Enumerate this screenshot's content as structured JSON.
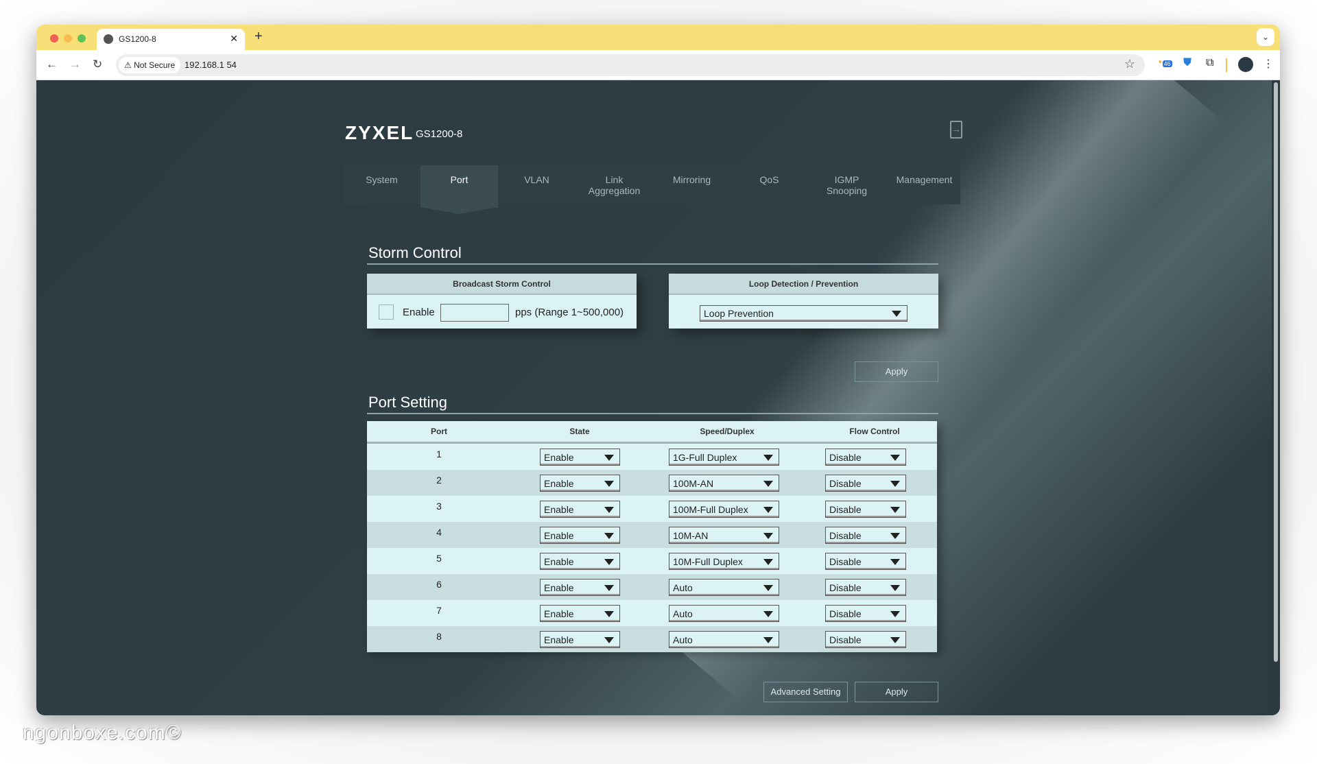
{
  "browser": {
    "tab_title": "GS1200-8",
    "new_tab_label": "+",
    "security_label": "Not Secure",
    "url": "192.168.1      54",
    "extension_badge": "46"
  },
  "app": {
    "brand": "ZYXEL",
    "model": "GS1200-8",
    "nav": [
      {
        "label": "System",
        "active": false
      },
      {
        "label": "Port",
        "active": true
      },
      {
        "label": "VLAN",
        "active": false
      },
      {
        "label": "Link\nAggregation",
        "active": false
      },
      {
        "label": "Mirroring",
        "active": false
      },
      {
        "label": "QoS",
        "active": false
      },
      {
        "label": "IGMP\nSnooping",
        "active": false
      },
      {
        "label": "Management",
        "active": false
      }
    ]
  },
  "storm_control": {
    "title": "Storm Control",
    "broadcast": {
      "header": "Broadcast Storm Control",
      "enable_label": "Enable",
      "enabled": false,
      "value": "",
      "unit_label": "pps (Range 1~500,000)"
    },
    "loop": {
      "header": "Loop Detection / Prevention",
      "selected": "Loop Prevention"
    },
    "apply_label": "Apply"
  },
  "port_setting": {
    "title": "Port Setting",
    "columns": [
      "Port",
      "State",
      "Speed/Duplex",
      "Flow Control"
    ],
    "rows": [
      {
        "port": "1",
        "state": "Enable",
        "speed": "1G-Full Duplex",
        "flow": "Disable"
      },
      {
        "port": "2",
        "state": "Enable",
        "speed": "100M-AN",
        "flow": "Disable"
      },
      {
        "port": "3",
        "state": "Enable",
        "speed": "100M-Full Duplex",
        "flow": "Disable"
      },
      {
        "port": "4",
        "state": "Enable",
        "speed": "10M-AN",
        "flow": "Disable"
      },
      {
        "port": "5",
        "state": "Enable",
        "speed": "10M-Full Duplex",
        "flow": "Disable"
      },
      {
        "port": "6",
        "state": "Enable",
        "speed": "Auto",
        "flow": "Disable"
      },
      {
        "port": "7",
        "state": "Enable",
        "speed": "Auto",
        "flow": "Disable"
      },
      {
        "port": "8",
        "state": "Enable",
        "speed": "Auto",
        "flow": "Disable"
      }
    ],
    "advanced_label": "Advanced Setting",
    "apply_label": "Apply"
  },
  "watermark": "ngonboxe.com©"
}
